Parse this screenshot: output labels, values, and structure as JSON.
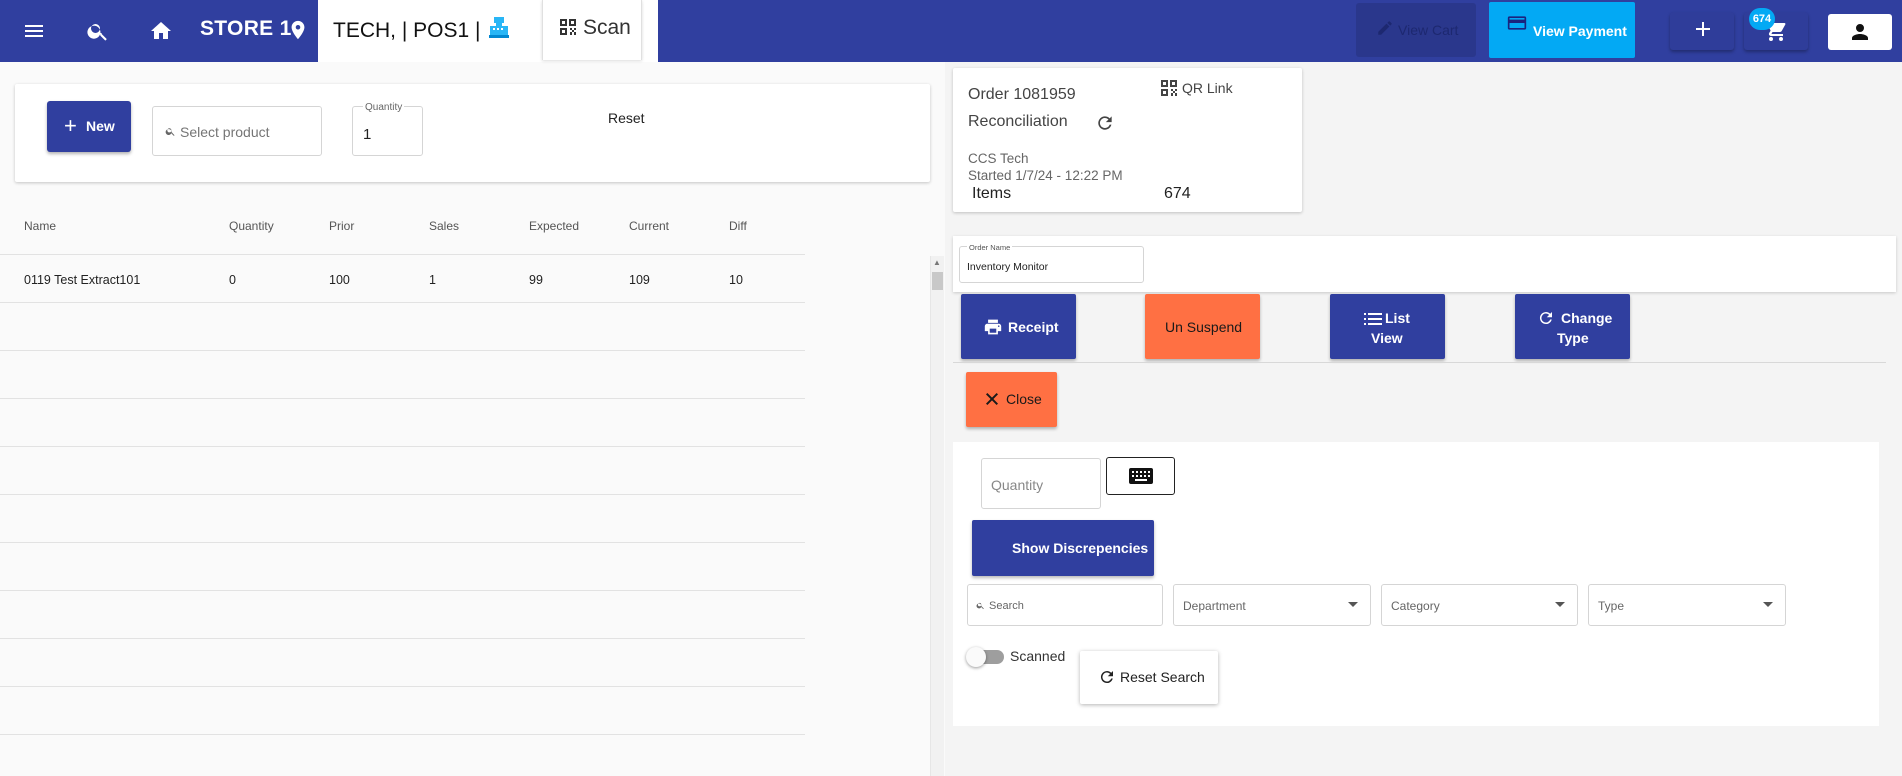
{
  "topbar": {
    "store": "STORE 1",
    "register": "TECH, | POS1 |",
    "scan_label": "Scan",
    "view_cart_label": "View Cart",
    "view_payment_label": "View Payment",
    "cart_count": "674"
  },
  "add_product": {
    "new_label": "New",
    "select_placeholder": "Select product",
    "quantity_label": "Quantity",
    "quantity_value": "1",
    "reset_label": "Reset"
  },
  "table": {
    "columns": [
      "Name",
      "Quantity",
      "Prior",
      "Sales",
      "Expected",
      "Current",
      "Diff"
    ],
    "rows": [
      {
        "name": "0119 Test Extract101",
        "quantity": "0",
        "prior": "100",
        "sales": "1",
        "expected": "99",
        "current": "109",
        "diff": "10"
      }
    ]
  },
  "order": {
    "number": "Order 1081959",
    "type": "Reconciliation",
    "qr_link": "QR Link",
    "user": "CCS Tech",
    "started": "Started 1/7/24 - 12:22 PM",
    "items_label": "Items",
    "items_value": "674",
    "name_label": "Order Name",
    "name_value": "Inventory Monitor"
  },
  "actions": {
    "receipt": "Receipt",
    "unsuspend": "Un Suspend",
    "list_view_1": "List",
    "list_view_2": "View",
    "change_type_1": "Change",
    "change_type_2": "Type",
    "close": "Close"
  },
  "filters": {
    "quantity_placeholder": "Quantity",
    "show_discrepancies": "Show Discrepencies",
    "search_placeholder": "Search",
    "department": "Department",
    "category": "Category",
    "type": "Type",
    "scanned_label": "Scanned",
    "scanned_on": false,
    "reset_search": "Reset Search"
  },
  "colors": {
    "primary": "#303f9f",
    "accent": "#03a9f4",
    "warn": "#ff7043"
  }
}
